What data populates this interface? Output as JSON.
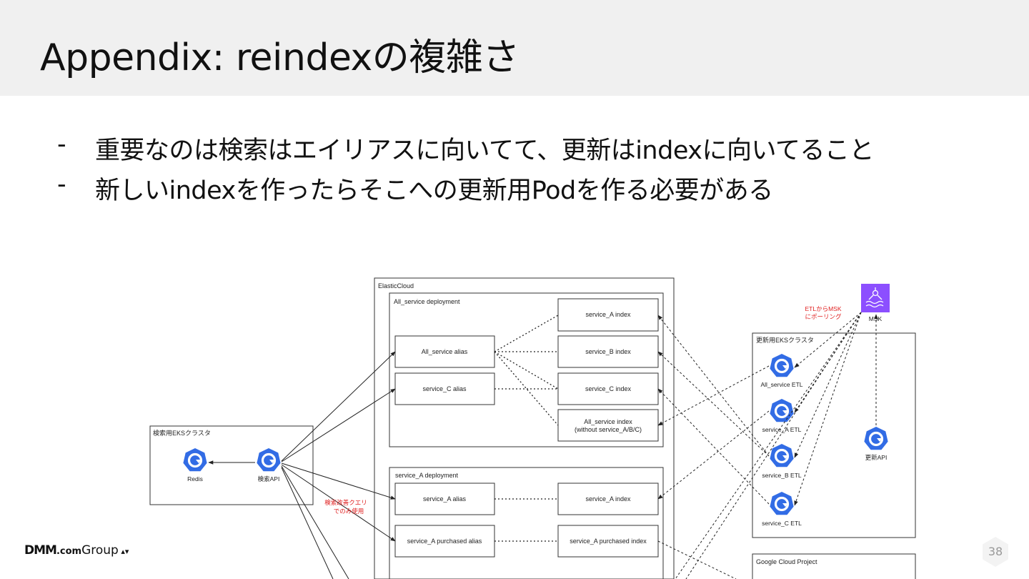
{
  "slide": {
    "title": "Appendix: reindexの複雑さ",
    "bullets": [
      {
        "dash": "-",
        "text": "重要なのは検索はエイリアスに向いてて、更新はindexに向いてること"
      },
      {
        "dash": "-",
        "text": "新しいindexを作ったらそこへの更新用Podを作る必要がある"
      }
    ],
    "logo": {
      "brand": "DMM",
      "dotcom": ".com",
      "group": "Group"
    },
    "page_number": "38"
  },
  "diagram": {
    "elastic_cloud": "ElasticCloud",
    "all_service_deployment": "All_service deployment",
    "all_service_alias": "All_service alias",
    "service_c_alias": "service_C alias",
    "service_a_index_1": "service_A index",
    "service_b_index": "service_B index",
    "service_c_index": "service_C index",
    "all_service_index_l1": "All_service index",
    "all_service_index_l2": "(without service_A/B/C)",
    "service_a_deployment": "service_A deployment",
    "service_a_alias": "service_A alias",
    "service_a_index_2": "service_A index",
    "service_a_purchased_alias": "service_A purchased alias",
    "service_a_purchased_index": "service_A purchased index",
    "search_cluster": "検索用EKSクラスタ",
    "redis": "Redis",
    "search_api": "検索API",
    "search_note_l1": "検索改善クエリ",
    "search_note_l2": "でのみ使用",
    "update_cluster": "更新用EKSクラスタ",
    "all_service_etl": "All_service ETL",
    "service_a_etl": "service_A ETL",
    "service_b_etl": "service_B ETL",
    "service_c_etl": "service_C ETL",
    "update_api": "更新API",
    "msk": "MSK",
    "msk_note_l1": "ETLからMSK",
    "msk_note_l2": "にポーリング",
    "google_cloud_project": "Google Cloud Project",
    "colors": {
      "k8s_blue": "#326ce5",
      "msk_purple": "#8c4fff",
      "note_red": "#e02020"
    }
  }
}
